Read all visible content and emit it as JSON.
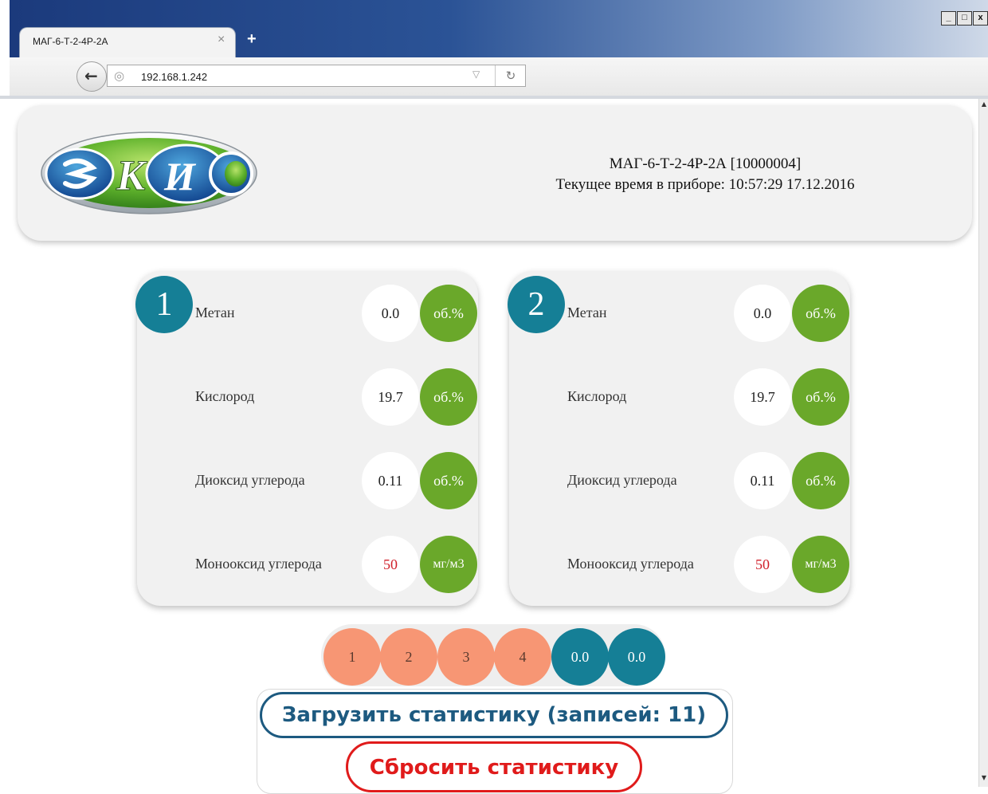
{
  "browser": {
    "tab_title": "МАГ-6-Т-2-4Р-2А",
    "tab_close": "×",
    "new_tab": "+",
    "url": "192.168.1.242",
    "window_controls": {
      "minimize": "_",
      "maximize": "□",
      "close": "x"
    }
  },
  "header": {
    "logo_text": "ЭКИС",
    "device_title": "МАГ-6-Т-2-4Р-2А [10000004]",
    "device_time": "Текущее время в приборе: 10:57:29 17.12.2016"
  },
  "panels": [
    {
      "number": "1",
      "rows": [
        {
          "name": "Метан",
          "value": "0.0",
          "unit": "об.%",
          "alert": false
        },
        {
          "name": "Кислород",
          "value": "19.7",
          "unit": "об.%",
          "alert": false
        },
        {
          "name": "Диоксид углерода",
          "value": "0.11",
          "unit": "об.%",
          "alert": false
        },
        {
          "name": "Монооксид углерода",
          "value": "50",
          "unit": "мг/м3",
          "alert": true
        }
      ]
    },
    {
      "number": "2",
      "rows": [
        {
          "name": "Метан",
          "value": "0.0",
          "unit": "об.%",
          "alert": false
        },
        {
          "name": "Кислород",
          "value": "19.7",
          "unit": "об.%",
          "alert": false
        },
        {
          "name": "Диоксид углерода",
          "value": "0.11",
          "unit": "об.%",
          "alert": false
        },
        {
          "name": "Монооксид углерода",
          "value": "50",
          "unit": "мг/м3",
          "alert": true
        }
      ]
    }
  ],
  "circles": [
    "1",
    "2",
    "3",
    "4",
    "0.0",
    "0.0"
  ],
  "buttons": {
    "load_stats": "Загрузить статистику (записей: 11)",
    "reset_stats": "Сбросить статистику"
  },
  "colors": {
    "accent_blue": "#157f96",
    "unit_green": "#6aa82a",
    "circle_orange": "#f79674",
    "alert_red": "#d0202a",
    "load_button": "#1d5a80",
    "reset_button": "#e01b1b"
  }
}
